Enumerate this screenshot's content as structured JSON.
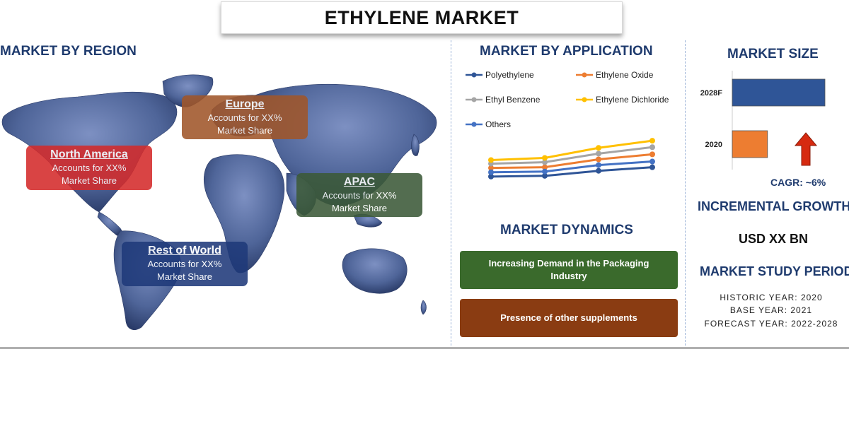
{
  "title": "ETHYLENE MARKET",
  "region": {
    "heading": "MARKET BY REGION",
    "boxes": [
      {
        "name": "North America",
        "line1": "Accounts for XX%",
        "line2": "Market Share",
        "color": "#d42b2b"
      },
      {
        "name": "Europe",
        "line1": "Accounts for XX%",
        "line2": "Market Share",
        "color": "#a0562a"
      },
      {
        "name": "APAC",
        "line1": "Accounts for XX%",
        "line2": "Market Share",
        "color": "#3c5a38"
      },
      {
        "name": "Rest of World",
        "line1": "Accounts for XX%",
        "line2": "Market Share",
        "color": "#1f3a7a"
      }
    ]
  },
  "application": {
    "heading": "MARKET BY APPLICATION",
    "legend": [
      "Polyethylene",
      "Ethylene Oxide",
      "Ethyl Benzene",
      "Ethylene Dichloride",
      "Others"
    ]
  },
  "chart_data": [
    {
      "type": "line",
      "x": [
        1,
        2,
        3,
        4
      ],
      "series": [
        {
          "name": "Polyethylene",
          "color": "#2f5597",
          "values": [
            1.2,
            1.3,
            2.0,
            2.5
          ]
        },
        {
          "name": "Ethylene Oxide",
          "color": "#ed7d31",
          "values": [
            2.4,
            2.5,
            3.6,
            4.3
          ]
        },
        {
          "name": "Ethyl Benzene",
          "color": "#a5a5a5",
          "values": [
            3.0,
            3.2,
            4.4,
            5.3
          ]
        },
        {
          "name": "Ethylene Dichloride",
          "color": "#ffc000",
          "values": [
            3.5,
            3.8,
            5.2,
            6.2
          ]
        },
        {
          "name": "Others",
          "color": "#4472c4",
          "values": [
            1.8,
            1.9,
            2.8,
            3.3
          ]
        }
      ],
      "ylim": [
        0,
        7
      ],
      "grid": false
    },
    {
      "type": "bar",
      "orientation": "horizontal",
      "categories": [
        "2028F",
        "2020"
      ],
      "values": [
        100,
        38
      ],
      "colors": [
        "#2f5597",
        "#ed7d31"
      ],
      "xlim": [
        0,
        100
      ]
    }
  ],
  "dynamics": {
    "heading": "MARKET DYNAMICS",
    "items": [
      {
        "text": "Increasing Demand in the Packaging Industry",
        "color": "#3a6a2c"
      },
      {
        "text": "Presence of other supplements",
        "color": "#8a3c12"
      }
    ]
  },
  "size": {
    "heading": "MARKET SIZE",
    "cagr": "CAGR:  ~6%",
    "arrow_color": "#d62a10",
    "incremental_heading": "INCREMENTAL GROWTH",
    "incremental_value": "USD XX BN",
    "study_heading": "MARKET STUDY PERIOD",
    "historic": "HISTORIC YEAR: 2020",
    "base": "BASE YEAR: 2021",
    "forecast": "FORECAST YEAR: 2022-2028"
  }
}
